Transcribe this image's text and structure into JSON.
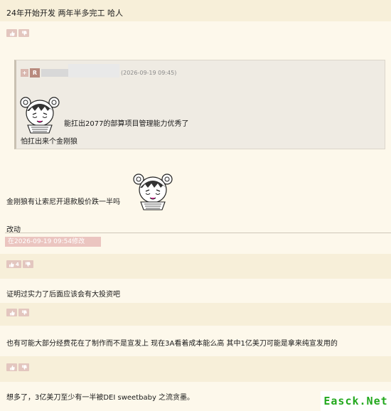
{
  "posts": [
    {
      "text": "24年开始开发 两年半多完工 哈人"
    },
    {
      "text": "金刚狼有让索尼开退款股价跌一半吗"
    },
    {
      "text": "证明过实力了后面应该会有大投资吧"
    },
    {
      "text": "也有可能大部分经费花在了制作而不是宣发上 现在3A看着成本能么高 其中1亿美刀可能是拿来纯宣发用的"
    },
    {
      "text": "想多了，3亿美刀至少有一半被DEI sweetbaby 之流贪墨。"
    }
  ],
  "vote_buttons": {
    "up_icon": "thumb-up-icon",
    "down_icon": "thumb-down-icon",
    "count_label": "4"
  },
  "quote": {
    "expand_label": "+",
    "badge_label": "R",
    "timestamp": "(2026-09-19 09:45)",
    "line1": "能扛出2077的部算项目管理能力优秀了",
    "line2": "怕扛出来个金刚狼"
  },
  "edit": {
    "label": "改动",
    "stamp": "在2026-09-19 09:54修改"
  },
  "watermark": "Easck.Net",
  "colors": {
    "background": "#fdf8eb",
    "band": "#f7efd9",
    "vote_button": "#e3c6bf",
    "edit_bar": "#ebc5c0",
    "watermark": "#22a81d"
  }
}
